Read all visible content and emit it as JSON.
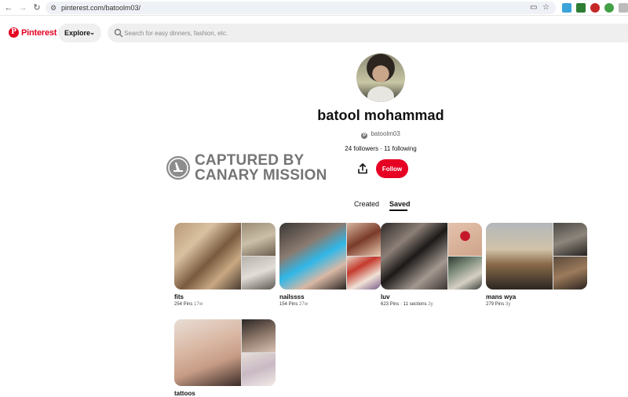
{
  "browser": {
    "url": "pinterest.com/batoolm03/",
    "back_icon": "arrow-left-icon",
    "forward_icon": "arrow-right-icon",
    "reload_icon": "reload-icon"
  },
  "header": {
    "logo_text": "Pinterest",
    "explore_label": "Explore",
    "search_placeholder": "Search for easy dinners, fashion, etc."
  },
  "profile": {
    "name": "batool mohammad",
    "handle": "batoolm03",
    "followers": "24 followers",
    "separator": " · ",
    "following": "11 following",
    "follow_label": "Follow"
  },
  "watermark": {
    "line1": "CAPTURED BY",
    "line2": "CANARY MISSION"
  },
  "tabs": {
    "created": "Created",
    "saved": "Saved"
  },
  "boards": [
    {
      "title": "fits",
      "pins": "254 Pins",
      "age": "17w"
    },
    {
      "title": "nailssss",
      "pins": "154 Pins",
      "age": "27w"
    },
    {
      "title": "luv",
      "pins": "623 Pins · 11 sections",
      "age": "2y"
    },
    {
      "title": "mans wya",
      "pins": "279 Pins",
      "age": "3y"
    },
    {
      "title": "tattoos",
      "pins": "",
      "age": ""
    }
  ],
  "colors": {
    "brand": "#e60023",
    "search_bg": "#efefef"
  }
}
